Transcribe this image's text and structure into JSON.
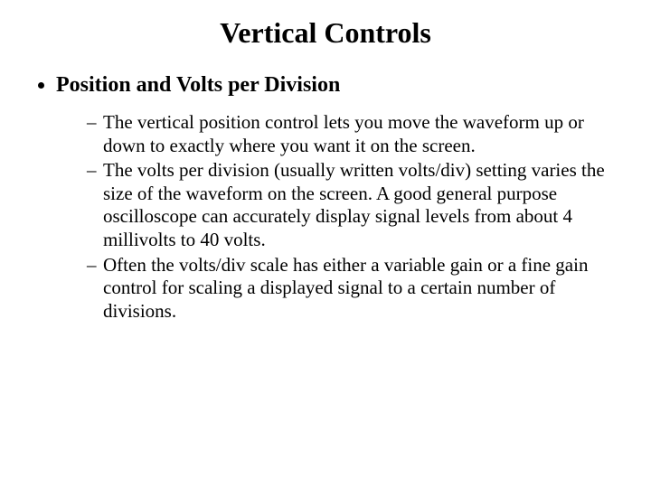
{
  "title": "Vertical Controls",
  "bullets": {
    "item1": {
      "label": "Position and Volts per Division",
      "sub1": "The vertical position control lets you move the waveform up or down to exactly where you want it on the screen.",
      "sub2": "The volts per division (usually written volts/div) setting varies the size of the waveform on the screen. A good general purpose oscilloscope can accurately display signal levels from about 4 millivolts to 40 volts.",
      "sub3": "Often the volts/div scale has either a variable gain or a fine gain control for scaling a displayed signal to a certain number of divisions."
    }
  }
}
